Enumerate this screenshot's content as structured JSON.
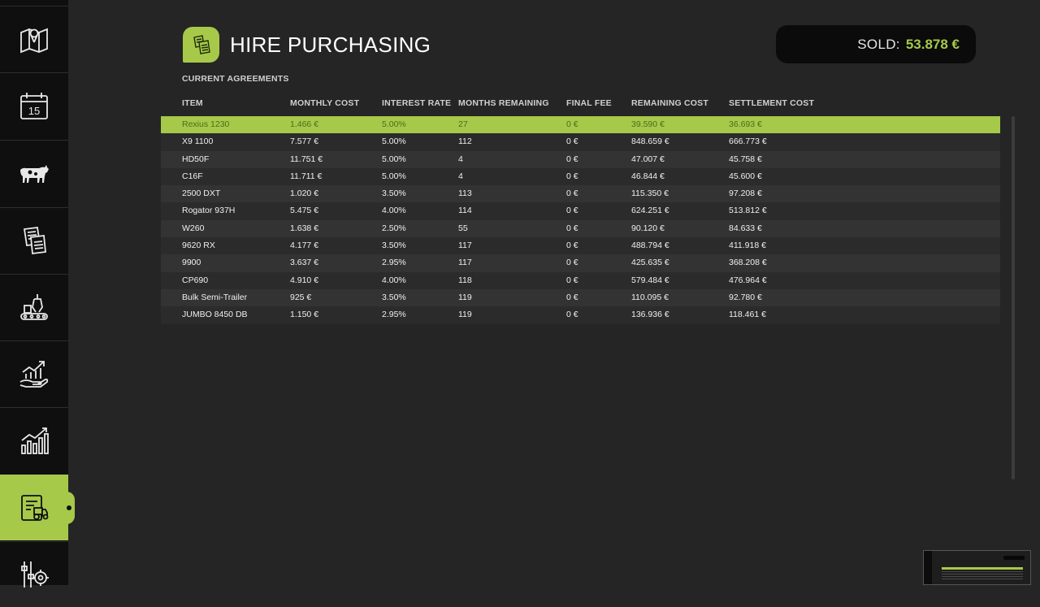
{
  "colors": {
    "accent": "#a6c94a",
    "sidebar_bg": "#0f0f0f",
    "main_bg": "#252525"
  },
  "sidebar": {
    "items": [
      {
        "icon": "map-icon",
        "active": false
      },
      {
        "icon": "calendar-icon",
        "label": "15",
        "active": false
      },
      {
        "icon": "cow-icon",
        "active": false
      },
      {
        "icon": "contracts-icon",
        "active": false
      },
      {
        "icon": "production-icon",
        "active": false
      },
      {
        "icon": "finance-growth-icon",
        "active": false
      },
      {
        "icon": "statistics-chart-icon",
        "active": false
      },
      {
        "icon": "hire-purchase-icon",
        "active": true
      },
      {
        "icon": "settings-sliders-icon",
        "active": false
      }
    ]
  },
  "header": {
    "title": "HIRE PURCHASING",
    "title_icon": "documents-icon",
    "balance_label": "SOLD:",
    "balance_value": "53.878 €"
  },
  "section_label": "CURRENT AGREEMENTS",
  "table": {
    "columns": [
      "ITEM",
      "MONTHLY COST",
      "INTEREST RATE",
      "MONTHS REMAINING",
      "FINAL FEE",
      "REMAINING COST",
      "SETTLEMENT COST"
    ],
    "rows": [
      [
        "Rexius 1230",
        "1.466 €",
        "5.00%",
        "27",
        "0 €",
        "39.590 €",
        "36.693 €"
      ],
      [
        "X9 1100",
        "7.577 €",
        "5.00%",
        "112",
        "0 €",
        "848.659 €",
        "666.773 €"
      ],
      [
        "HD50F",
        "11.751 €",
        "5.00%",
        "4",
        "0 €",
        "47.007 €",
        "45.758 €"
      ],
      [
        "C16F",
        "11.711 €",
        "5.00%",
        "4",
        "0 €",
        "46.844 €",
        "45.600 €"
      ],
      [
        "2500 DXT",
        "1.020 €",
        "3.50%",
        "113",
        "0 €",
        "115.350 €",
        "97.208 €"
      ],
      [
        "Rogator 937H",
        "5.475 €",
        "4.00%",
        "114",
        "0 €",
        "624.251 €",
        "513.812 €"
      ],
      [
        "W260",
        "1.638 €",
        "2.50%",
        "55",
        "0 €",
        "90.120 €",
        "84.633 €"
      ],
      [
        "9620 RX",
        "4.177 €",
        "3.50%",
        "117",
        "0 €",
        "488.794 €",
        "411.918 €"
      ],
      [
        "9900",
        "3.637 €",
        "2.95%",
        "117",
        "0 €",
        "425.635 €",
        "368.208 €"
      ],
      [
        "CP690",
        "4.910 €",
        "4.00%",
        "118",
        "0 €",
        "579.484 €",
        "476.964 €"
      ],
      [
        "Bulk Semi-Trailer",
        "925 €",
        "3.50%",
        "119",
        "0 €",
        "110.095 €",
        "92.780 €"
      ],
      [
        "JUMBO 8450 DB",
        "1.150 €",
        "2.95%",
        "119",
        "0 €",
        "136.936 €",
        "118.461 €"
      ]
    ],
    "selected_row": 0
  }
}
